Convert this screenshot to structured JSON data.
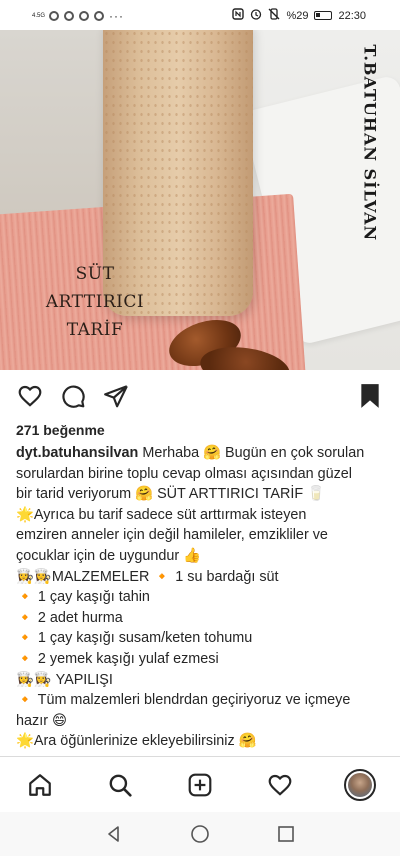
{
  "status_bar": {
    "network": "4.5G",
    "more": "···",
    "battery_text": "%29",
    "time": "22:30",
    "icons": [
      "nfc-icon",
      "alarm-icon",
      "mute-icon",
      "battery-icon"
    ]
  },
  "post": {
    "image_overlay": {
      "title_lines": [
        "SÜT",
        "ARTTIRICI",
        "TARİF"
      ],
      "watermark": "T.BATUHAN SİLVAN"
    },
    "actions": [
      "like-icon",
      "comment-icon",
      "share-icon",
      "save-icon"
    ],
    "likes": "271 beğenme",
    "username": "dyt.batuhansilvan",
    "caption_lines": [
      "Merhaba 🤗 Bugün en çok sorulan",
      "sorulardan birine toplu cevap olması açısından güzel",
      "bir tarid veriyorum 🤗 SÜT ARTTIRICI TARİF 🥛",
      "🌟Ayrıca bu tarif sadece süt arttırmak isteyen",
      "emziren anneler için değil hamileler, emzikliler ve",
      "çocuklar için de uygundur 👍",
      "👩‍🍳👩‍🍳MALZEMELER  🔸 1 su bardağı süt",
      "🔸 1 çay kaşığı tahin",
      "🔸 2 adet hurma",
      "🔸 1 çay kaşığı susam/keten tohumu",
      "🔸 2 yemek kaşığı yulaf ezmesi",
      "👩‍🍳👩‍🍳 YAPILIŞI",
      "🔸 Tüm malzemleri blendrdan geçiriyoruz ve içmeye",
      "hazır 😄",
      "🌟Ara öğünlerinize ekleyebilirsiniz 🤗"
    ]
  },
  "bottom_nav": [
    "home-icon",
    "search-icon",
    "new-post-icon",
    "activity-icon",
    "profile-avatar"
  ],
  "system_nav": [
    "back-icon",
    "home-circle-icon",
    "recents-icon"
  ]
}
